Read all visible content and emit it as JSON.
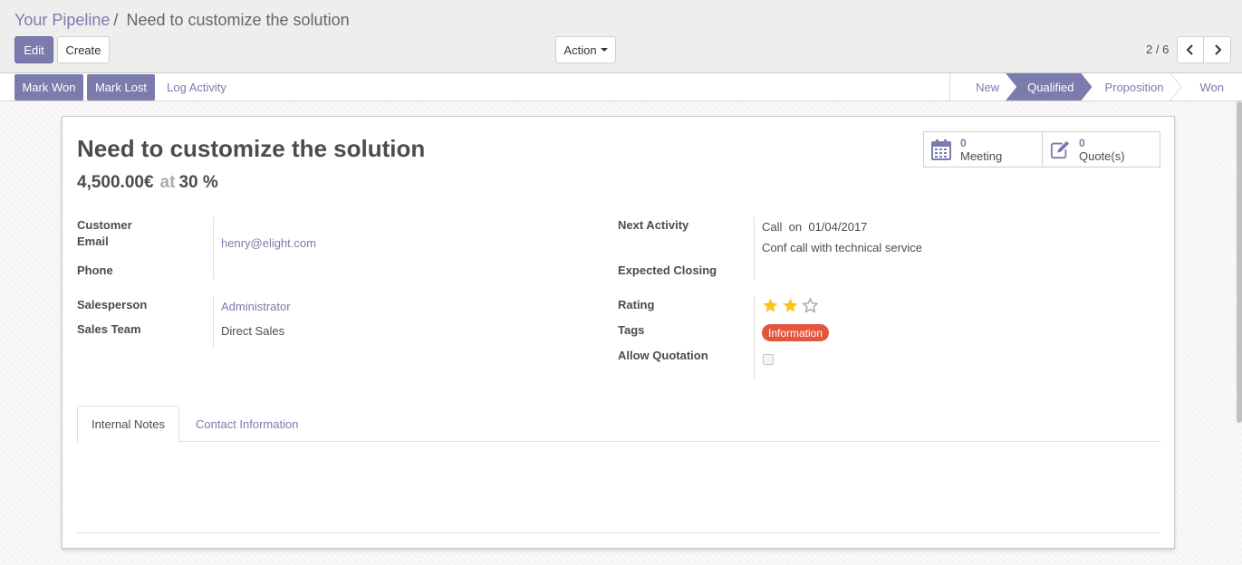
{
  "breadcrumb": {
    "parent": "Your Pipeline",
    "separator": "/",
    "current": "Need to customize the solution"
  },
  "toolbar": {
    "edit_label": "Edit",
    "create_label": "Create",
    "action_label": "Action"
  },
  "pager": {
    "value": "2 / 6",
    "prev_icon": "chevron-left-icon",
    "next_icon": "chevron-right-icon"
  },
  "statusbar": {
    "mark_won": "Mark Won",
    "mark_lost": "Mark Lost",
    "log_activity": "Log Activity",
    "stages": [
      "New",
      "Qualified",
      "Proposition",
      "Won"
    ],
    "current_stage": "Qualified"
  },
  "record": {
    "title": "Need to customize the solution",
    "revenue": "4,500.00€",
    "at_label": "at",
    "probability": "30 %"
  },
  "smart_buttons": [
    {
      "count": "0",
      "label": "Meeting",
      "icon": "calendar-icon"
    },
    {
      "count": "0",
      "label": "Quote(s)",
      "icon": "edit-icon"
    }
  ],
  "left_fields": {
    "customer_label": "Customer",
    "email_label": "Email",
    "email_value": "henry@elight.com",
    "phone_label": "Phone",
    "salesperson_label": "Salesperson",
    "salesperson_value": "Administrator",
    "sales_team_label": "Sales Team",
    "sales_team_value": "Direct Sales"
  },
  "right_fields": {
    "next_activity_label": "Next Activity",
    "activity_type": "Call",
    "activity_on": "on",
    "activity_date": "01/04/2017",
    "activity_summary": "Conf call with technical service",
    "expected_closing_label": "Expected Closing",
    "rating_label": "Rating",
    "rating_value": 2,
    "rating_max": 3,
    "tags_label": "Tags",
    "tag_value": "Information",
    "allow_quotation_label": "Allow Quotation",
    "allow_quotation_checked": false
  },
  "tabs": [
    {
      "label": "Internal Notes",
      "active": true
    },
    {
      "label": "Contact Information",
      "active": false
    }
  ],
  "colors": {
    "primary": "#7c7bad",
    "tag": "#e4553e",
    "star": "#f5c518"
  }
}
